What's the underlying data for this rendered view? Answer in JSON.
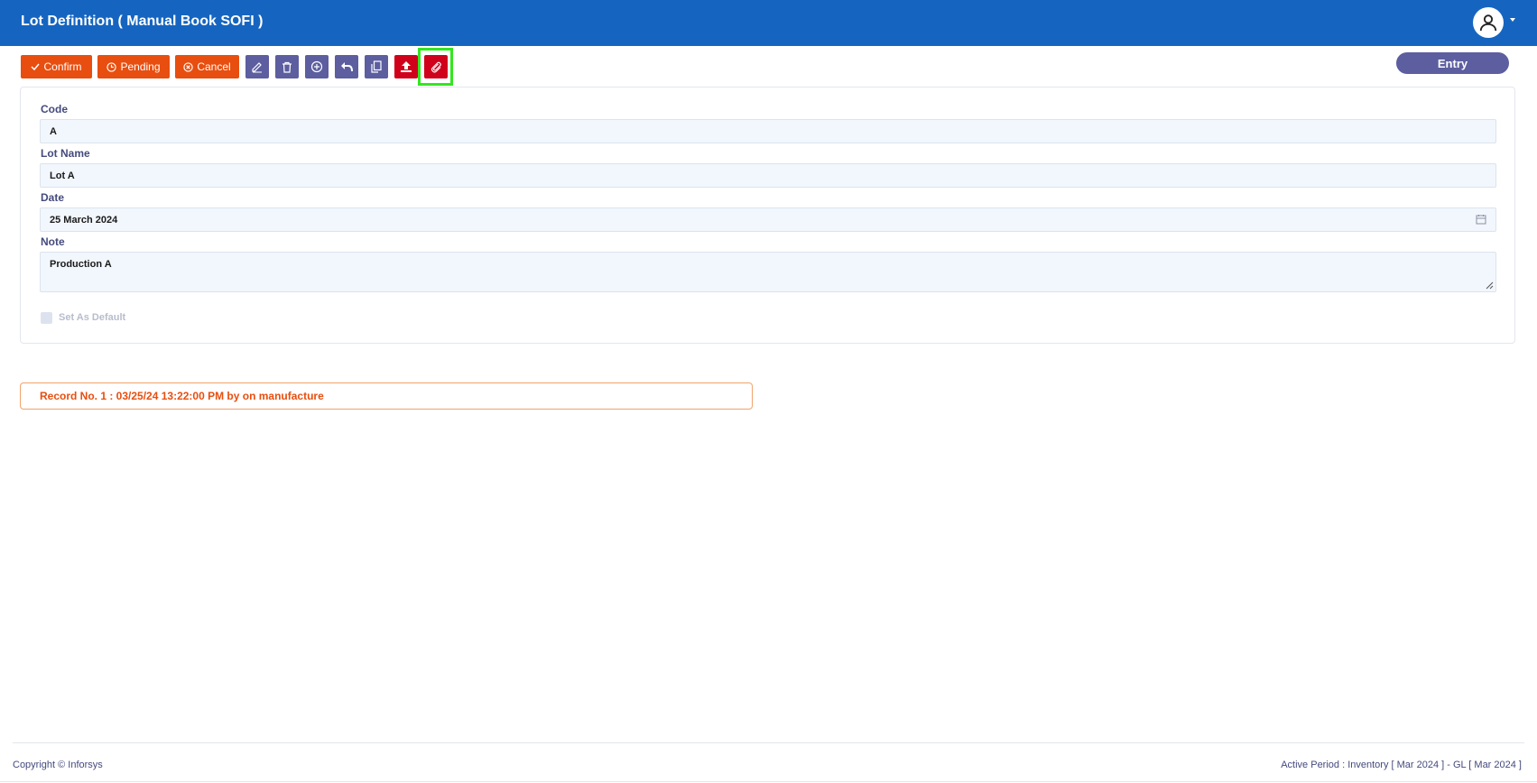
{
  "header": {
    "title": "Lot Definition ( Manual Book SOFI )",
    "avatar_icon": "user-icon"
  },
  "toolbar": {
    "confirm_label": "Confirm",
    "pending_label": "Pending",
    "cancel_label": "Cancel",
    "icons": [
      "edit-icon",
      "trash-icon",
      "add-icon",
      "undo-icon",
      "copy-icon",
      "upload-icon",
      "attach-icon"
    ]
  },
  "status_badge": "Entry",
  "form": {
    "code_label": "Code",
    "code_value": "A",
    "lot_name_label": "Lot Name",
    "lot_name_value": "Lot A",
    "date_label": "Date",
    "date_value": "25 March 2024",
    "note_label": "Note",
    "note_value": "Production A",
    "default_label": "Set As Default"
  },
  "record_info": "Record No. 1 : 03/25/24 13:22:00 PM by on manufacture",
  "footer": {
    "copyright": "Copyright © Inforsys",
    "period": "Active Period  :  Inventory [ Mar 2024 ]  -  GL [ Mar 2024 ]"
  },
  "colors": {
    "header": "#1565c0",
    "accent_orange": "#e84e0f",
    "icon_button": "#5c5ea0",
    "danger": "#d0021b",
    "highlight": "#33e61f"
  }
}
